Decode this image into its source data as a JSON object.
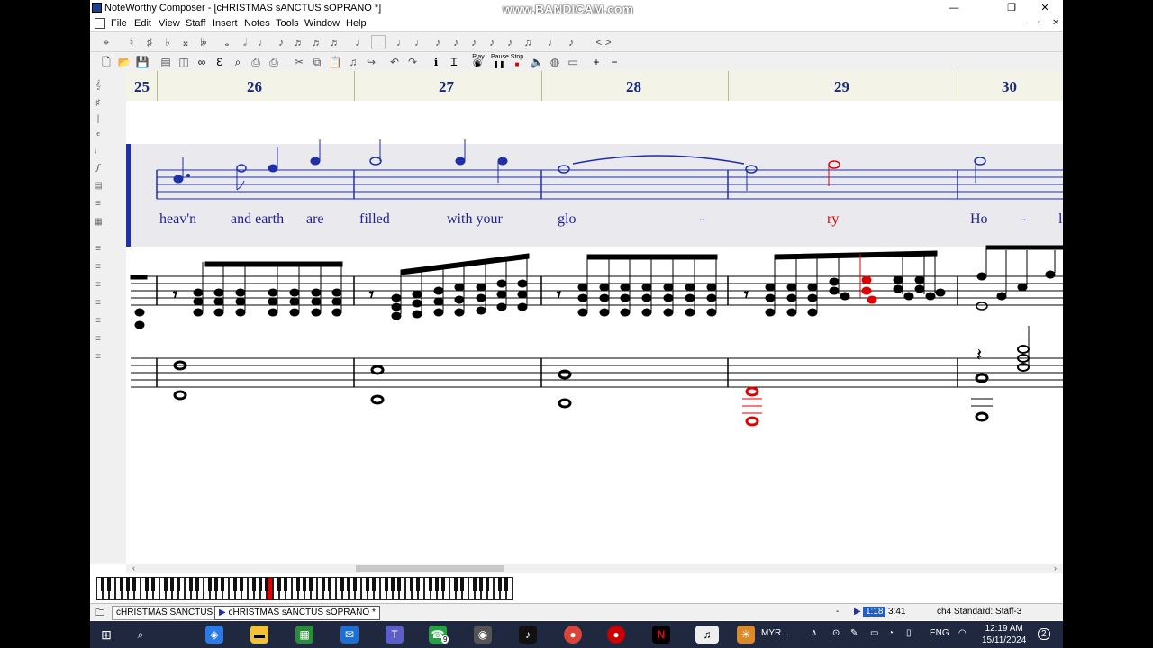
{
  "window": {
    "title": "NoteWorthy Composer - [cHRISTMAS sANCTUS sOPRANO *]",
    "minimize_glyph": "—",
    "restore_glyph": "❐",
    "close_glyph": "✕",
    "doc_minimize": "–",
    "doc_restore": "▫",
    "doc_close": "✕"
  },
  "watermark": "www.BANDICAM.com",
  "menu": [
    "File",
    "Edit",
    "View",
    "Staff",
    "Insert",
    "Notes",
    "Tools",
    "Window",
    "Help"
  ],
  "toolbar": {
    "play_label": "Play",
    "pause_label": "Pause",
    "stop_label": "Stop"
  },
  "score": {
    "measure_numbers": [
      "25",
      "26",
      "27",
      "28",
      "29",
      "30"
    ],
    "lyrics": [
      "heav'n",
      "and earth",
      "are",
      "filled",
      "with your",
      "glo",
      "-",
      "ry",
      "Ho",
      "-",
      "l"
    ],
    "highlight_color": "#e00000",
    "soprano_color": "#1f2fa8"
  },
  "tabs": [
    {
      "label": "cHRISTMAS SANCTUS *"
    },
    {
      "label": "cHRISTMAS sANCTUS sOPRANO *"
    }
  ],
  "status": {
    "dash": "-",
    "position": "1:18",
    "duration": "3:41",
    "staff_info": "ch4 Standard: Staff-3"
  },
  "taskbar": {
    "pinned_label": "MYR...",
    "badge_count": "9",
    "language": "ENG",
    "time": "12:19 AM",
    "date": "15/11/2024",
    "notification_count": "2"
  }
}
